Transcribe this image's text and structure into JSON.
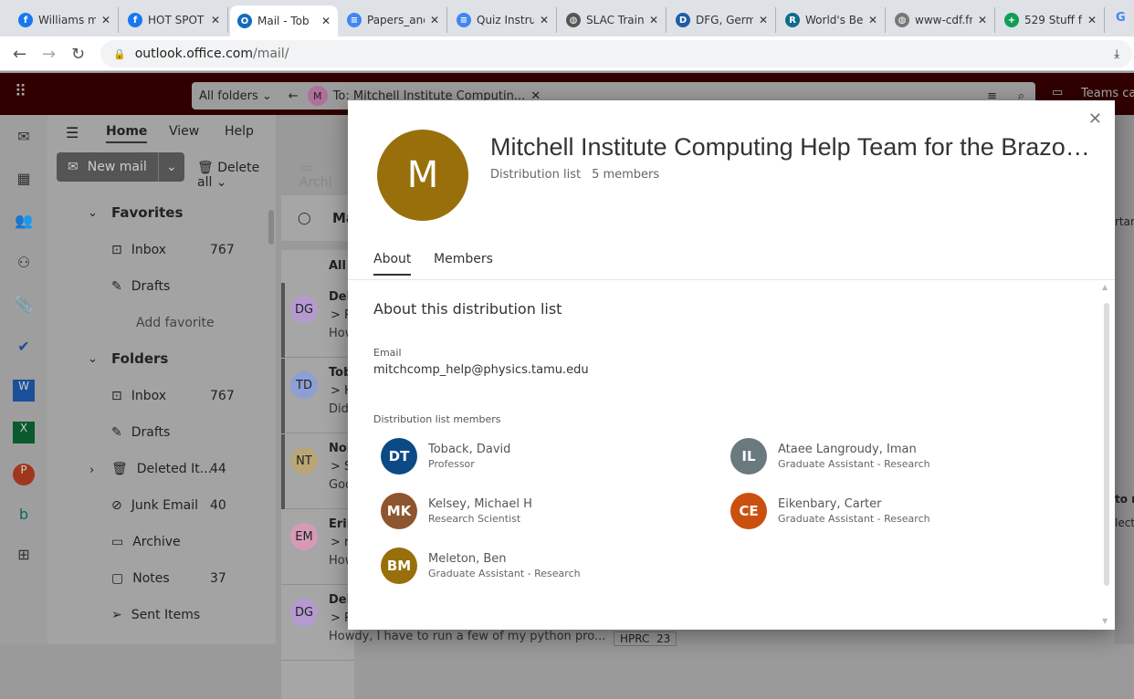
{
  "browser": {
    "tabs": [
      {
        "title": "Williams m",
        "icon": "facebook-icon",
        "color": "#1877f2",
        "glyph": "f"
      },
      {
        "title": "HOT SPOT",
        "icon": "facebook-icon",
        "color": "#1877f2",
        "glyph": "f"
      },
      {
        "title": "Mail - Tob",
        "icon": "outlook-icon",
        "color": "#0f6cbd",
        "glyph": "O",
        "active": true
      },
      {
        "title": "Papers_and",
        "icon": "docs-icon",
        "color": "#4285f4",
        "glyph": "≡"
      },
      {
        "title": "Quiz Instru",
        "icon": "docs-icon",
        "color": "#4285f4",
        "glyph": "≡"
      },
      {
        "title": "SLAC Train",
        "icon": "globe-icon",
        "color": "#555",
        "glyph": "◍"
      },
      {
        "title": "DFG, Germ",
        "icon": "dfg-icon",
        "color": "#1d5ca8",
        "glyph": "D"
      },
      {
        "title": "World's Be",
        "icon": "r-icon",
        "color": "#0f6c8c",
        "glyph": "R"
      },
      {
        "title": "www-cdf.fn",
        "icon": "globe-icon",
        "color": "#777",
        "glyph": "◍"
      },
      {
        "title": "529 Stuff f",
        "icon": "sheets-icon",
        "color": "#0f9d58",
        "glyph": "+"
      }
    ],
    "url_host": "outlook.office.com",
    "url_path": "/mail/"
  },
  "outlook": {
    "search": {
      "scope": "All folders",
      "chip_avatar": "M",
      "chip_text": "To: Mitchell Institute Computin...",
      "teams": "Teams cal"
    },
    "ribbon": {
      "tabs": [
        "Home",
        "View",
        "Help"
      ],
      "new_mail": "New mail",
      "delete_all": "Delete all",
      "archive": "Archi"
    },
    "favorites": {
      "header": "Favorites",
      "items": [
        {
          "label": "Inbox",
          "count": "767"
        },
        {
          "label": "Drafts",
          "count": ""
        }
      ],
      "add": "Add favorite"
    },
    "folders": {
      "header": "Folders",
      "items": [
        {
          "label": "Inbox",
          "count": "767"
        },
        {
          "label": "Drafts",
          "count": ""
        },
        {
          "label": "Deleted It...",
          "count": "44"
        },
        {
          "label": "Junk Email",
          "count": "40"
        },
        {
          "label": "Archive",
          "count": ""
        },
        {
          "label": "Notes",
          "count": "37"
        },
        {
          "label": "Sent Items",
          "count": ""
        }
      ]
    },
    "list": {
      "tab": "Ma",
      "filter": "All",
      "messages": [
        {
          "initials": "DG",
          "color": "#b59ad0",
          "name": "Deb",
          "subject": "> R",
          "preview": "How"
        },
        {
          "initials": "TD",
          "color": "#8d9fd4",
          "name": "Tob",
          "subject": "> H",
          "preview": "Did"
        },
        {
          "initials": "NT",
          "color": "#b9a678",
          "name": "Nol",
          "subject": "> S",
          "preview": "Goo"
        },
        {
          "initials": "EM",
          "color": "#d69ab8",
          "name": "Erik",
          "subject": "> r",
          "preview": "How"
        },
        {
          "initials": "DG",
          "color": "#b59ad0",
          "name": "Deb",
          "subject": "> R",
          "preview": "Howdy, I have to run a few of my python pro..."
        }
      ],
      "tag": "HPRC",
      "tag_count": "23"
    },
    "reading": {
      "label1": "rtan",
      "label2": "to r",
      "label3": "lect"
    }
  },
  "modal": {
    "avatar": "M",
    "avatar_color": "#986f0b",
    "title": "Mitchell Institute Computing Help Team for the Brazos...",
    "type": "Distribution list",
    "members_count": "5 members",
    "tabs": [
      "About",
      "Members"
    ],
    "section_title": "About this distribution list",
    "email_label": "Email",
    "email": "mitchcomp_help@physics.tamu.edu",
    "members_label": "Distribution list members",
    "members": [
      {
        "initials": "DT",
        "name": "Toback, David",
        "role": "Professor",
        "color": "#0b4a86"
      },
      {
        "initials": "IL",
        "name": "Ataee Langroudy, Iman",
        "role": "Graduate Assistant - Research",
        "color": "#69797e"
      },
      {
        "initials": "MK",
        "name": "Kelsey, Michael H",
        "role": "Research Scientist",
        "color": "#8e562e"
      },
      {
        "initials": "CE",
        "name": "Eikenbary, Carter",
        "role": "Graduate Assistant - Research",
        "color": "#ca5010"
      },
      {
        "initials": "BM",
        "name": "Meleton, Ben",
        "role": "Graduate Assistant - Research",
        "color": "#986f0b"
      }
    ]
  }
}
